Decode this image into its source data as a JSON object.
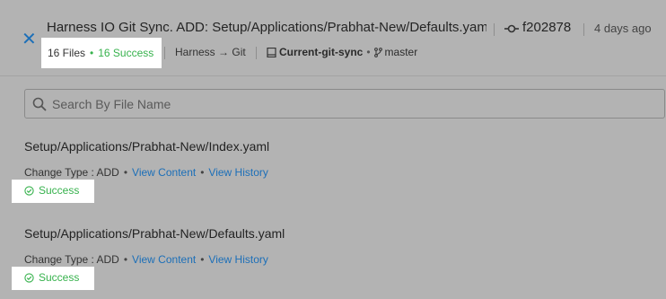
{
  "header": {
    "title": "Harness IO Git Sync. ADD: Setup/Applications/Prabhat-New/Defaults.yaml ...",
    "commit_hash": "f202878",
    "time_ago": "4 days ago",
    "files_count": "16 Files",
    "success_count": "16 Success",
    "direction_from": "Harness",
    "direction_arrow": "→",
    "direction_to": "Git",
    "repo_name": "Current-git-sync",
    "branch": "master"
  },
  "search": {
    "placeholder": "Search By File Name"
  },
  "files": [
    {
      "path": "Setup/Applications/Prabhat-New/Index.yaml",
      "change_label": "Change Type : ADD",
      "view_content": "View Content",
      "view_history": "View History",
      "status": "Success"
    },
    {
      "path": "Setup/Applications/Prabhat-New/Defaults.yaml",
      "change_label": "Change Type : ADD",
      "view_content": "View Content",
      "view_history": "View History",
      "status": "Success"
    }
  ],
  "colors": {
    "accent": "#1c6fb8",
    "success": "#37b24d",
    "overlay_bg": "#b3b3b3"
  },
  "icons": [
    "close-icon",
    "commit-icon",
    "repo-icon",
    "branch-icon",
    "search-icon",
    "check-circle-icon"
  ]
}
